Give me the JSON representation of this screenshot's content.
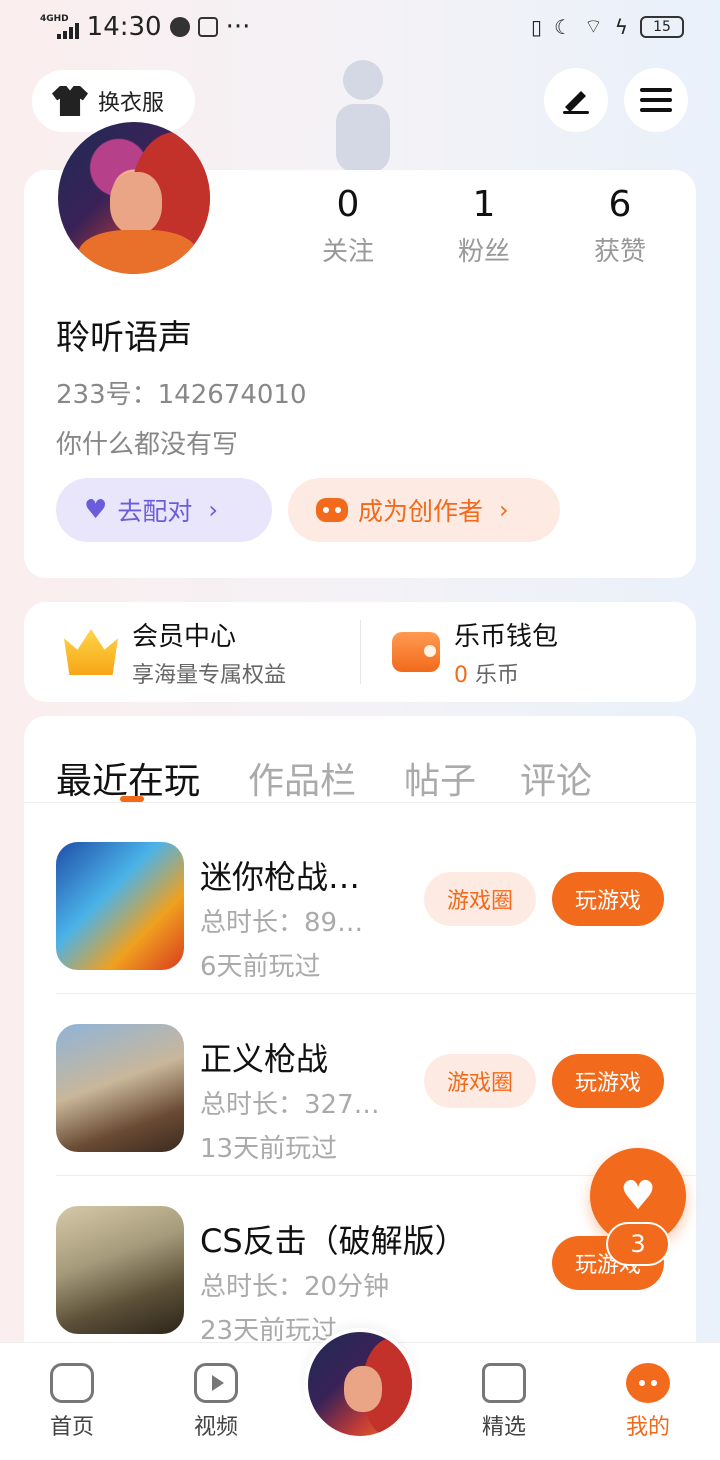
{
  "status_bar": {
    "time": "14:30",
    "network": "4GHD",
    "more": "···",
    "battery": "15"
  },
  "header": {
    "dress_label": "换衣服"
  },
  "profile": {
    "stats": [
      {
        "num": "0",
        "label": "关注"
      },
      {
        "num": "1",
        "label": "粉丝"
      },
      {
        "num": "6",
        "label": "获赞"
      }
    ],
    "nickname": "聆听语声",
    "uid": "233号：142674010",
    "bio": "你什么都没有写",
    "pair_label": "去配对",
    "creator_label": "成为创作者"
  },
  "vip": {
    "member_title": "会员中心",
    "member_sub": "享海量专属权益",
    "wallet_title": "乐币钱包",
    "wallet_amount": "0",
    "wallet_unit": "乐币"
  },
  "tabs": [
    "最近在玩",
    "作品栏",
    "帖子",
    "评论"
  ],
  "games": [
    {
      "name": "迷你枪战…",
      "time": "总时长：89…",
      "ago": "6天前玩过",
      "circle": "游戏圈",
      "play": "玩游戏"
    },
    {
      "name": "正义枪战",
      "time": "总时长：327…",
      "ago": "13天前玩过",
      "circle": "游戏圈",
      "play": "玩游戏"
    },
    {
      "name": "CS反击（破解版）",
      "time": "总时长：20分钟",
      "ago": "23天前玩过",
      "play": "玩游戏"
    }
  ],
  "float": {
    "badge": "3"
  },
  "nav": [
    "首页",
    "视频",
    "精选",
    "我的"
  ]
}
